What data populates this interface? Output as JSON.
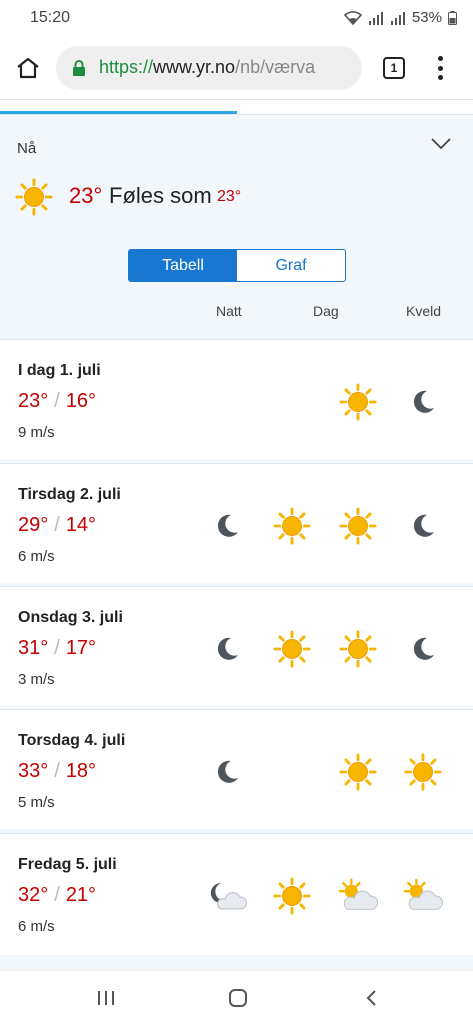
{
  "status": {
    "time": "15:20",
    "battery": "53%"
  },
  "browser": {
    "url_scheme": "https://",
    "url_host": "www.yr.no",
    "url_path": "/nb/værva",
    "tab_count": "1"
  },
  "now": {
    "label": "Nå",
    "temp": "23°",
    "feels_label": "Føles som",
    "feels_temp": "23°",
    "icon": "sun-icon"
  },
  "view_toggle": {
    "table_label": "Tabell",
    "graph_label": "Graf",
    "selected": "Tabell"
  },
  "columns": {
    "night": "Natt",
    "day": "Dag",
    "evening": "Kveld"
  },
  "colors": {
    "temp_warm": "#c60000",
    "accent": "#1877d1",
    "panel_bg": "#f1f7fb"
  },
  "days": [
    {
      "title": "I dag 1. juli",
      "max": "23°",
      "min": "16°",
      "wind": "9 m/s",
      "icons": [
        "",
        "",
        "sun",
        "moon"
      ]
    },
    {
      "title": "Tirsdag 2. juli",
      "max": "29°",
      "min": "14°",
      "wind": "6 m/s",
      "icons": [
        "moon",
        "sun",
        "sun",
        "moon"
      ]
    },
    {
      "title": "Onsdag 3. juli",
      "max": "31°",
      "min": "17°",
      "wind": "3 m/s",
      "icons": [
        "moon",
        "sun",
        "sun",
        "moon"
      ]
    },
    {
      "title": "Torsdag 4. juli",
      "max": "33°",
      "min": "18°",
      "wind": "5 m/s",
      "icons": [
        "moon",
        "",
        "sun",
        "sun"
      ]
    },
    {
      "title": "Fredag 5. juli",
      "max": "32°",
      "min": "21°",
      "wind": "6 m/s",
      "icons": [
        "moon-cloud",
        "sun",
        "sun-cloud",
        "sun-cloud"
      ]
    }
  ]
}
